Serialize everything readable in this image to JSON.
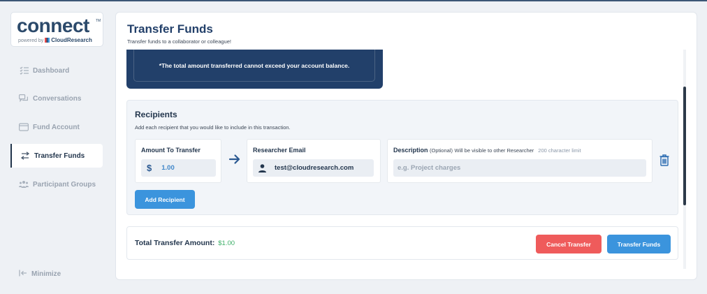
{
  "brand": {
    "logo_text": "connect",
    "powered_by": "powered by",
    "partner": "CloudResearch",
    "trademark": "TM"
  },
  "sidebar": {
    "items": [
      {
        "label": "Dashboard",
        "icon": "list-icon",
        "active": false
      },
      {
        "label": "Conversations",
        "icon": "chat-icon",
        "active": false
      },
      {
        "label": "Fund Account",
        "icon": "wallet-icon",
        "active": false
      },
      {
        "label": "Transfer Funds",
        "icon": "transfer-icon",
        "active": true
      },
      {
        "label": "Participant Groups",
        "icon": "group-icon",
        "active": false
      }
    ],
    "minimize_label": "Minimize"
  },
  "page": {
    "title": "Transfer Funds",
    "subtitle": "Transfer funds to a collaborator or colleague!"
  },
  "notice": {
    "text": "*The total amount transferred cannot exceed your account balance."
  },
  "recipients": {
    "title": "Recipients",
    "description": "Add each recipient that you would like to include in this transaction.",
    "amount": {
      "label": "Amount To Transfer",
      "currency_symbol": "$",
      "value": "1.00"
    },
    "email": {
      "label": "Researcher Email",
      "value": "test@cloudresearch.com"
    },
    "description_field": {
      "label": "Description",
      "optional": "(Optional)",
      "hint": "Will be visible to other Researcher",
      "limit": "200 character limit",
      "placeholder": "e.g. Project charges"
    },
    "add_button": "Add Recipient"
  },
  "total": {
    "label": "Total Transfer Amount:",
    "value": "$1.00"
  },
  "actions": {
    "cancel": "Cancel Transfer",
    "transfer": "Transfer Funds"
  },
  "colors": {
    "primary": "#3b94dd",
    "navy": "#22406a",
    "danger": "#ef5b5b",
    "success": "#3cae67"
  }
}
